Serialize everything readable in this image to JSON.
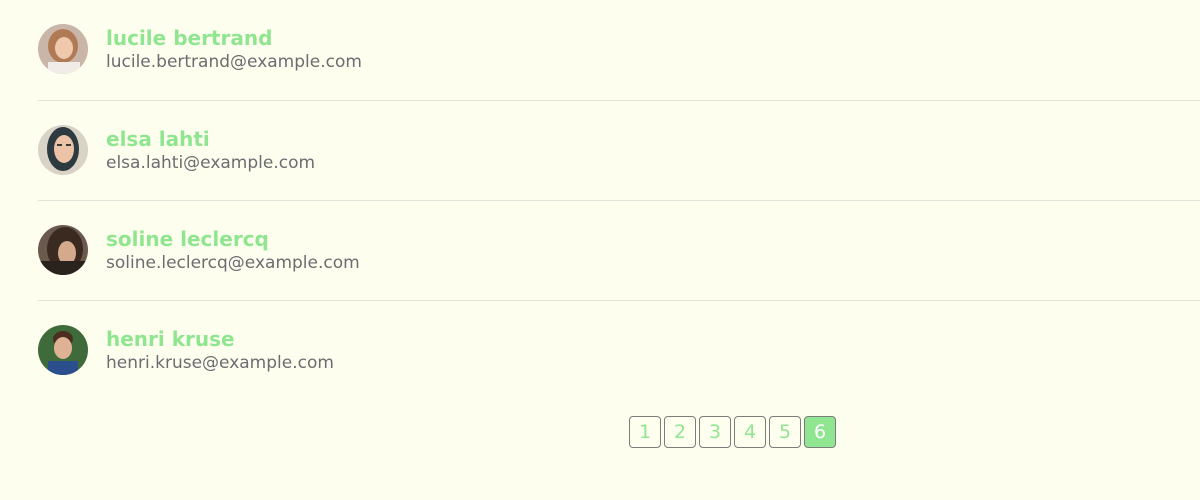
{
  "users": [
    {
      "name": "lucile bertrand",
      "email": "lucile.bertrand@example.com"
    },
    {
      "name": "elsa lahti",
      "email": "elsa.lahti@example.com"
    },
    {
      "name": "soline leclercq",
      "email": "soline.leclercq@example.com"
    },
    {
      "name": "henri kruse",
      "email": "henri.kruse@example.com"
    }
  ],
  "pagination": {
    "pages": [
      "1",
      "2",
      "3",
      "4",
      "5",
      "6"
    ],
    "current": "6"
  },
  "colors": {
    "background": "#fefeee",
    "accent": "#90e690",
    "email_text": "#6c6c72",
    "divider": "#e2e2d8",
    "page_border": "#7d7d7d"
  }
}
